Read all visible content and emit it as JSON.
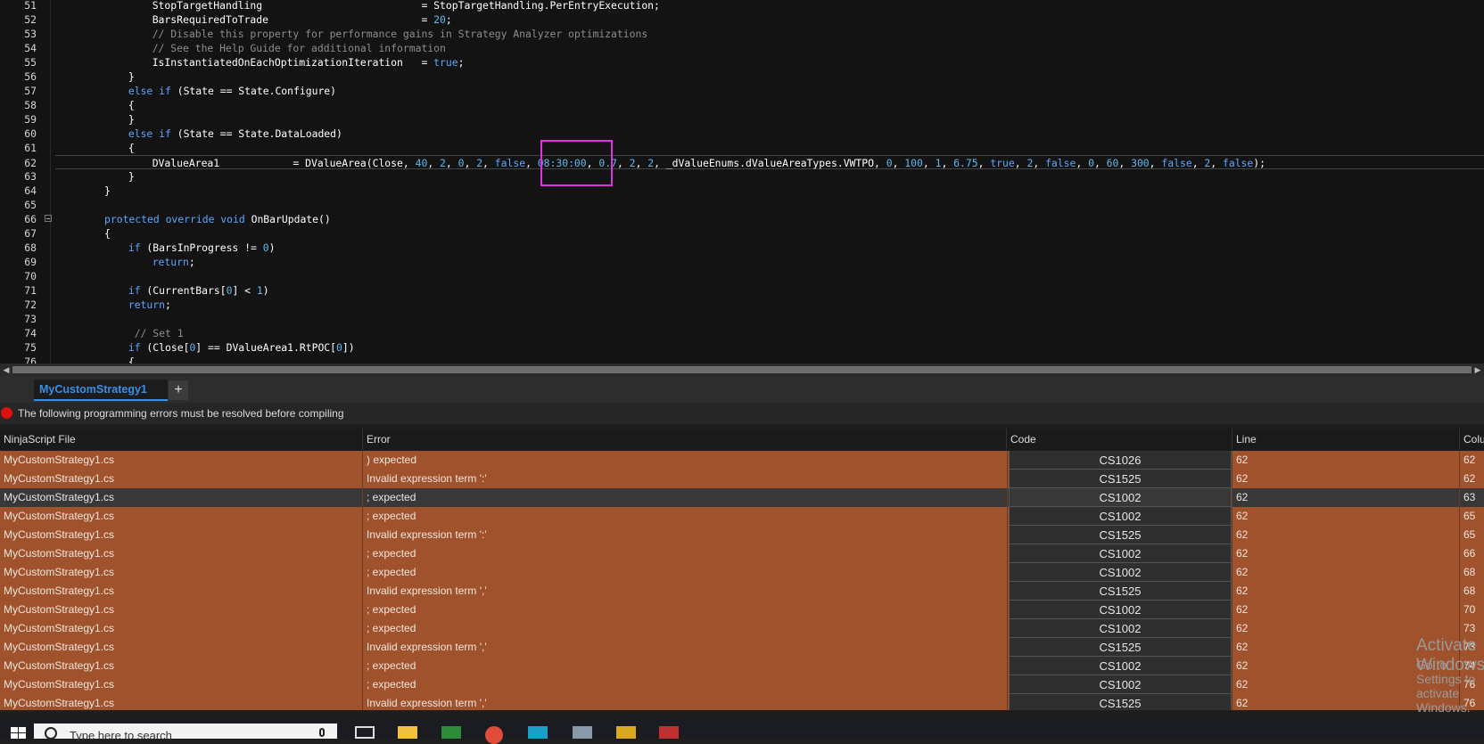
{
  "editor": {
    "lines": [
      {
        "n": "51",
        "indent": 4,
        "parts": [
          [
            "t",
            "StopTargetHandling                          = StopTargetHandling.PerEntryExecution;"
          ]
        ]
      },
      {
        "n": "52",
        "indent": 4,
        "parts": [
          [
            "t",
            "BarsRequiredToTrade                         = "
          ],
          [
            "n",
            "20"
          ],
          [
            "t",
            ";"
          ]
        ]
      },
      {
        "n": "53",
        "indent": 4,
        "parts": [
          [
            "c",
            "// Disable this property for performance gains in Strategy Analyzer optimizations"
          ]
        ]
      },
      {
        "n": "54",
        "indent": 4,
        "parts": [
          [
            "c",
            "// See the Help Guide for additional information"
          ]
        ]
      },
      {
        "n": "55",
        "indent": 4,
        "parts": [
          [
            "t",
            "IsInstantiatedOnEachOptimizationIteration   = "
          ],
          [
            "k",
            "true"
          ],
          [
            "t",
            ";"
          ]
        ]
      },
      {
        "n": "56",
        "indent": 2,
        "parts": [
          [
            "t",
            "}"
          ]
        ]
      },
      {
        "n": "57",
        "indent": 2,
        "parts": [
          [
            "k",
            "else if"
          ],
          [
            "t",
            " (State == State.Configure)"
          ]
        ]
      },
      {
        "n": "58",
        "indent": 2,
        "parts": [
          [
            "t",
            "{"
          ]
        ]
      },
      {
        "n": "59",
        "indent": 2,
        "parts": [
          [
            "t",
            "}"
          ]
        ]
      },
      {
        "n": "60",
        "indent": 2,
        "parts": [
          [
            "k",
            "else if"
          ],
          [
            "t",
            " (State == State.DataLoaded)"
          ]
        ]
      },
      {
        "n": "61",
        "indent": 2,
        "parts": [
          [
            "t",
            "{"
          ]
        ]
      },
      {
        "n": "62",
        "indent": 4,
        "cur": true,
        "parts": [
          [
            "t",
            "DValueArea1            = DValueArea(Close, "
          ],
          [
            "n",
            "40"
          ],
          [
            "t",
            ", "
          ],
          [
            "n",
            "2"
          ],
          [
            "t",
            ", "
          ],
          [
            "n",
            "0"
          ],
          [
            "t",
            ", "
          ],
          [
            "n",
            "2"
          ],
          [
            "t",
            ", "
          ],
          [
            "k",
            "false"
          ],
          [
            "t",
            ", "
          ],
          [
            "n",
            "08:30:00"
          ],
          [
            "t",
            ", "
          ],
          [
            "n",
            "0.7"
          ],
          [
            "t",
            ", "
          ],
          [
            "n",
            "2"
          ],
          [
            "t",
            ", "
          ],
          [
            "n",
            "2"
          ],
          [
            "t",
            ", _dValueEnums.dValueAreaTypes.VWTPO, "
          ],
          [
            "n",
            "0"
          ],
          [
            "t",
            ", "
          ],
          [
            "n",
            "100"
          ],
          [
            "t",
            ", "
          ],
          [
            "n",
            "1"
          ],
          [
            "t",
            ", "
          ],
          [
            "n",
            "6.75"
          ],
          [
            "t",
            ", "
          ],
          [
            "k",
            "true"
          ],
          [
            "t",
            ", "
          ],
          [
            "n",
            "2"
          ],
          [
            "t",
            ", "
          ],
          [
            "k",
            "false"
          ],
          [
            "t",
            ", "
          ],
          [
            "n",
            "0"
          ],
          [
            "t",
            ", "
          ],
          [
            "n",
            "60"
          ],
          [
            "t",
            ", "
          ],
          [
            "n",
            "300"
          ],
          [
            "t",
            ", "
          ],
          [
            "k",
            "false"
          ],
          [
            "t",
            ", "
          ],
          [
            "n",
            "2"
          ],
          [
            "t",
            ", "
          ],
          [
            "k",
            "false"
          ],
          [
            "t",
            ");"
          ]
        ]
      },
      {
        "n": "63",
        "indent": 2,
        "parts": [
          [
            "t",
            "}"
          ]
        ]
      },
      {
        "n": "64",
        "indent": 0,
        "parts": [
          [
            "t",
            "}"
          ]
        ]
      },
      {
        "n": "65",
        "indent": 0,
        "parts": []
      },
      {
        "n": "66",
        "indent": 0,
        "fold": true,
        "parts": [
          [
            "k",
            "protected override void"
          ],
          [
            "t",
            " OnBarUpdate()"
          ]
        ]
      },
      {
        "n": "67",
        "indent": 0,
        "parts": [
          [
            "t",
            "{"
          ]
        ]
      },
      {
        "n": "68",
        "indent": 2,
        "parts": [
          [
            "k",
            "if"
          ],
          [
            "t",
            " (BarsInProgress != "
          ],
          [
            "n",
            "0"
          ],
          [
            "t",
            ")"
          ]
        ]
      },
      {
        "n": "69",
        "indent": 4,
        "parts": [
          [
            "k",
            "return"
          ],
          [
            "t",
            ";"
          ]
        ]
      },
      {
        "n": "70",
        "indent": 0,
        "parts": []
      },
      {
        "n": "71",
        "indent": 2,
        "parts": [
          [
            "k",
            "if"
          ],
          [
            "t",
            " (CurrentBars["
          ],
          [
            "n",
            "0"
          ],
          [
            "t",
            "] < "
          ],
          [
            "n",
            "1"
          ],
          [
            "t",
            ")"
          ]
        ]
      },
      {
        "n": "72",
        "indent": 2,
        "parts": [
          [
            "k",
            "return"
          ],
          [
            "t",
            ";"
          ]
        ]
      },
      {
        "n": "73",
        "indent": 0,
        "parts": []
      },
      {
        "n": "74",
        "indent": 2,
        "parts": [
          [
            "c",
            " // Set 1"
          ]
        ]
      },
      {
        "n": "75",
        "indent": 2,
        "parts": [
          [
            "k",
            "if"
          ],
          [
            "t",
            " (Close["
          ],
          [
            "n",
            "0"
          ],
          [
            "t",
            "] == DValueArea1.RtPOC["
          ],
          [
            "n",
            "0"
          ],
          [
            "t",
            "])"
          ]
        ]
      },
      {
        "n": "76",
        "indent": 2,
        "parts": [
          [
            "t",
            "{"
          ]
        ]
      }
    ]
  },
  "tabs": {
    "active_label": "MyCustomStrategy1",
    "add_label": "+"
  },
  "banner": {
    "text": "The following programming errors must be resolved before compiling"
  },
  "grid": {
    "columns": [
      "NinjaScript File",
      "Error",
      "Code",
      "Line",
      "Column"
    ],
    "rows": [
      {
        "file": "MyCustomStrategy1.cs",
        "error": ") expected",
        "code": "CS1026",
        "line": "62",
        "col": "62"
      },
      {
        "file": "MyCustomStrategy1.cs",
        "error": "Invalid expression term ':'",
        "code": "CS1525",
        "line": "62",
        "col": "62"
      },
      {
        "file": "MyCustomStrategy1.cs",
        "error": "; expected",
        "code": "CS1002",
        "line": "62",
        "col": "63",
        "sel": true
      },
      {
        "file": "MyCustomStrategy1.cs",
        "error": "; expected",
        "code": "CS1002",
        "line": "62",
        "col": "65"
      },
      {
        "file": "MyCustomStrategy1.cs",
        "error": "Invalid expression term ':'",
        "code": "CS1525",
        "line": "62",
        "col": "65"
      },
      {
        "file": "MyCustomStrategy1.cs",
        "error": "; expected",
        "code": "CS1002",
        "line": "62",
        "col": "66"
      },
      {
        "file": "MyCustomStrategy1.cs",
        "error": "; expected",
        "code": "CS1002",
        "line": "62",
        "col": "68"
      },
      {
        "file": "MyCustomStrategy1.cs",
        "error": "Invalid expression term ','",
        "code": "CS1525",
        "line": "62",
        "col": "68"
      },
      {
        "file": "MyCustomStrategy1.cs",
        "error": "; expected",
        "code": "CS1002",
        "line": "62",
        "col": "70"
      },
      {
        "file": "MyCustomStrategy1.cs",
        "error": "; expected",
        "code": "CS1002",
        "line": "62",
        "col": "73"
      },
      {
        "file": "MyCustomStrategy1.cs",
        "error": "Invalid expression term ','",
        "code": "CS1525",
        "line": "62",
        "col": "73"
      },
      {
        "file": "MyCustomStrategy1.cs",
        "error": "; expected",
        "code": "CS1002",
        "line": "62",
        "col": "74"
      },
      {
        "file": "MyCustomStrategy1.cs",
        "error": "; expected",
        "code": "CS1002",
        "line": "62",
        "col": "76"
      },
      {
        "file": "MyCustomStrategy1.cs",
        "error": "Invalid expression term ','",
        "code": "CS1525",
        "line": "62",
        "col": "76"
      }
    ]
  },
  "watermark": {
    "line1": "Activate Windows",
    "line2": "Go to Settings to activate Windows."
  },
  "taskbar": {
    "search_placeholder": "Type here to search",
    "icons": [
      "task-view-icon",
      "file-explorer-icon",
      "app-green-icon",
      "chrome-icon",
      "ninjatrader-icon",
      "app-gray-icon",
      "pubg-icon",
      "app-red-icon"
    ]
  },
  "colors": {
    "error_row": "#a0522d",
    "selected_row": "#383838",
    "tab_accent": "#3a8ee6",
    "highlight_box": "#e033e0"
  }
}
